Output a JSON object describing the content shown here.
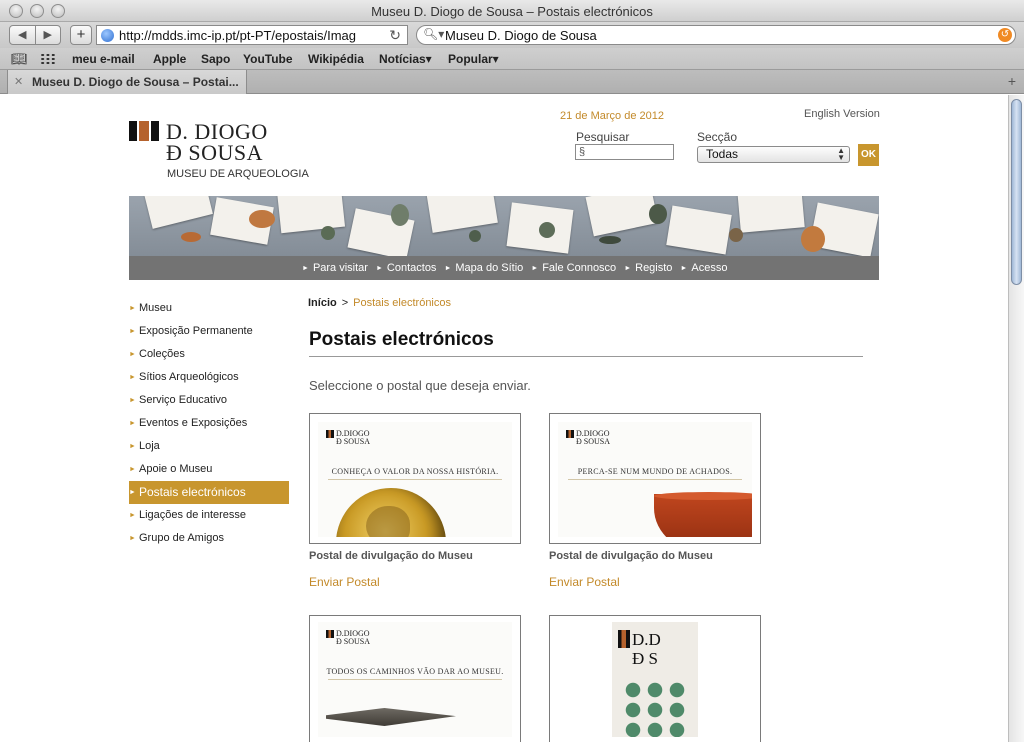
{
  "browser": {
    "window_title": "Museu D. Diogo de Sousa – Postais electrónicos",
    "url": "http://mdds.imc-ip.pt/pt-PT/epostais/Imag",
    "search_query": "Museu D. Diogo de Sousa",
    "bookmarks": [
      "meu e-mail",
      "Apple",
      "Sapo",
      "YouTube",
      "Wikipédia",
      "Notícias▾",
      "Popular▾"
    ],
    "tab_title": "Museu D. Diogo de Sousa – Postai..."
  },
  "header": {
    "logo_line1": "D. DIOGO",
    "logo_line2": "Đ SOUSA",
    "logo_line3": "MUSEU DE ARQUEOLOGIA",
    "date": "21 de Março de 2012",
    "english_link": "English Version",
    "search_label": "Pesquisar",
    "search_value": "§",
    "section_label": "Secção",
    "section_value": "Todas",
    "ok_label": "OK"
  },
  "topnav": [
    "Para visitar",
    "Contactos",
    "Mapa do Sítio",
    "Fale Connosco",
    "Registo",
    "Acesso"
  ],
  "sidebar": [
    {
      "label": "Museu",
      "active": false
    },
    {
      "label": "Exposição Permanente",
      "active": false
    },
    {
      "label": "Coleções",
      "active": false
    },
    {
      "label": "Sítios Arqueológicos",
      "active": false
    },
    {
      "label": "Serviço Educativo",
      "active": false
    },
    {
      "label": "Eventos e Exposições",
      "active": false
    },
    {
      "label": "Loja",
      "active": false
    },
    {
      "label": "Apoie o Museu",
      "active": false
    },
    {
      "label": "Postais electrónicos",
      "active": true
    },
    {
      "label": "Ligações de interesse",
      "active": false
    },
    {
      "label": "Grupo de Amigos",
      "active": false
    }
  ],
  "main": {
    "breadcrumb_home": "Início",
    "breadcrumb_sep": ">",
    "breadcrumb_current": "Postais electrónicos",
    "title": "Postais electrónicos",
    "intro": "Seleccione o postal que deseja enviar.",
    "postcards": [
      {
        "slogan": "CONHEÇA O VALOR DA NOSSA HISTÓRIA.",
        "caption": "Postal de divulgação do Museu",
        "link": "Enviar Postal",
        "image": "gold-coin"
      },
      {
        "slogan": "PERCA-SE NUM MUNDO DE ACHADOS.",
        "caption": "Postal de divulgação do Museu",
        "link": "Enviar Postal",
        "image": "terracotta-bowl"
      },
      {
        "slogan": "TODOS OS CAMINHOS VÃO DAR AO MUSEU.",
        "caption": "",
        "link": "",
        "image": "spearhead"
      },
      {
        "slogan": "",
        "caption": "",
        "link": "",
        "image": "coin-grid"
      }
    ],
    "postcard_logo_line1": "D.DIOGO",
    "postcard_logo_line2": "Đ SOUSA",
    "coin_poster_line1": "D.D",
    "coin_poster_line2": "Đ S"
  },
  "colors": {
    "accent": "#c8962e",
    "nav_gray": "#737373",
    "brand_brown": "#b5622d"
  }
}
